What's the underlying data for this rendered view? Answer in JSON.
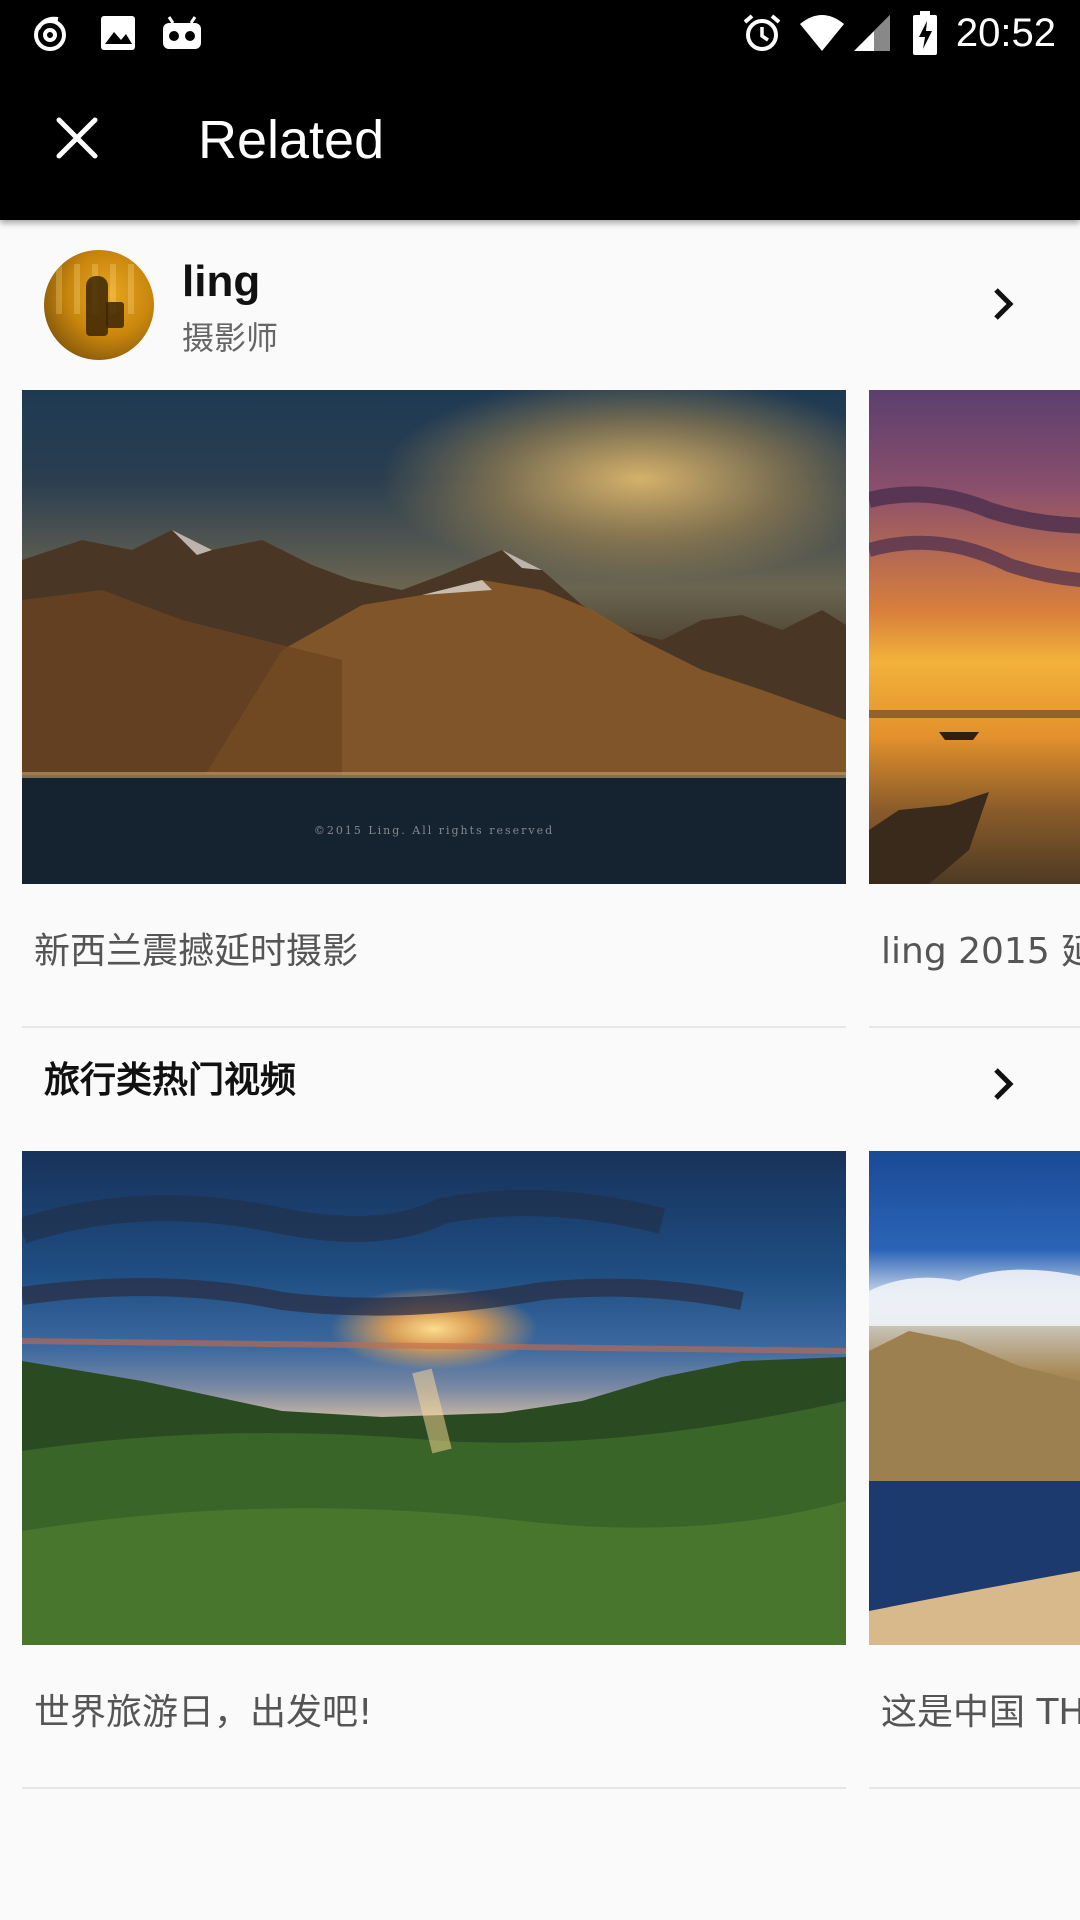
{
  "status_bar": {
    "time": "20:52",
    "left_icons": [
      "notification-swirl-icon",
      "image-icon",
      "robot-icon"
    ],
    "right_icons": [
      "alarm-icon",
      "wifi-icon",
      "signal-icon",
      "battery-charging-icon"
    ]
  },
  "app_bar": {
    "close_icon": "close-icon",
    "title": "Related"
  },
  "author": {
    "name": "ling",
    "subtitle": "摄影师",
    "chevron_icon": "chevron-right-icon"
  },
  "author_videos": [
    {
      "caption": "新西兰震撼延时摄影",
      "watermark": "©2015 Ling. All rights reserved"
    },
    {
      "caption": "ling 2015 延"
    }
  ],
  "section": {
    "title": "旅行类热门视频",
    "chevron_icon": "chevron-right-icon"
  },
  "travel_videos": [
    {
      "caption": "世界旅游日，出发吧!"
    },
    {
      "caption": "这是中国 TH"
    }
  ]
}
